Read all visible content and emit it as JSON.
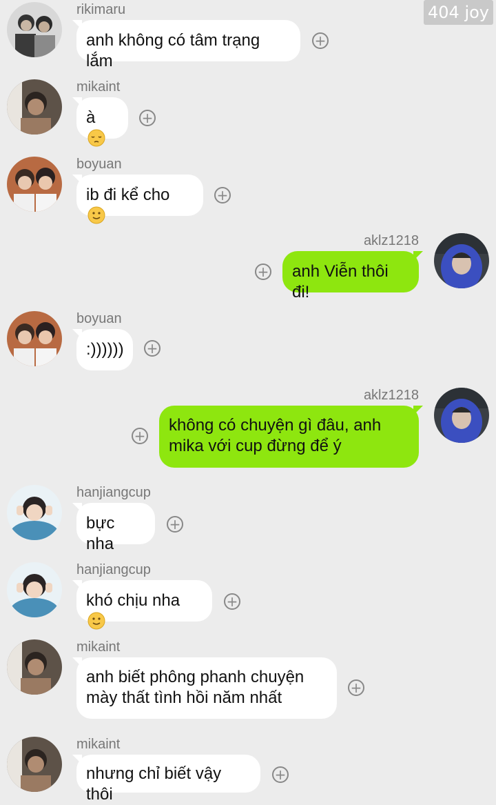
{
  "watermark": "404 joy",
  "colors": {
    "background": "#ececec",
    "incoming_bubble": "#ffffff",
    "outgoing_bubble": "#8ee60f",
    "sender_text": "#777777"
  },
  "messages": [
    {
      "sender": "rikimaru",
      "side": "left",
      "lines": [
        "anh không có tâm trạng lắm"
      ],
      "emoji": ""
    },
    {
      "sender": "mikaint",
      "side": "left",
      "lines": [
        "à"
      ],
      "emoji": "pensive-face"
    },
    {
      "sender": "boyuan",
      "side": "left",
      "lines": [
        "ib đi kể cho"
      ],
      "emoji": "slightly-smiling-face"
    },
    {
      "sender": "aklz1218",
      "side": "right",
      "lines": [
        "anh Viễn thôi đi!"
      ],
      "emoji": ""
    },
    {
      "sender": "boyuan",
      "side": "left",
      "lines": [
        ":))))))"
      ],
      "emoji": ""
    },
    {
      "sender": "aklz1218",
      "side": "right",
      "lines": [
        "không có chuyện gì đâu, anh",
        "mika với cup đừng để ý"
      ],
      "emoji": ""
    },
    {
      "sender": "hanjiangcup",
      "side": "left",
      "lines": [
        "bực nha"
      ],
      "emoji": ""
    },
    {
      "sender": "hanjiangcup",
      "side": "left",
      "lines": [
        "khó chịu nha"
      ],
      "emoji": "slightly-smiling-face"
    },
    {
      "sender": "mikaint",
      "side": "left",
      "lines": [
        "anh biết phông phanh chuyện",
        "mày thất tình hồi năm nhất"
      ],
      "emoji": ""
    },
    {
      "sender": "mikaint",
      "side": "left",
      "lines": [
        "nhưng chỉ biết vậy thôi"
      ],
      "emoji": ""
    }
  ]
}
